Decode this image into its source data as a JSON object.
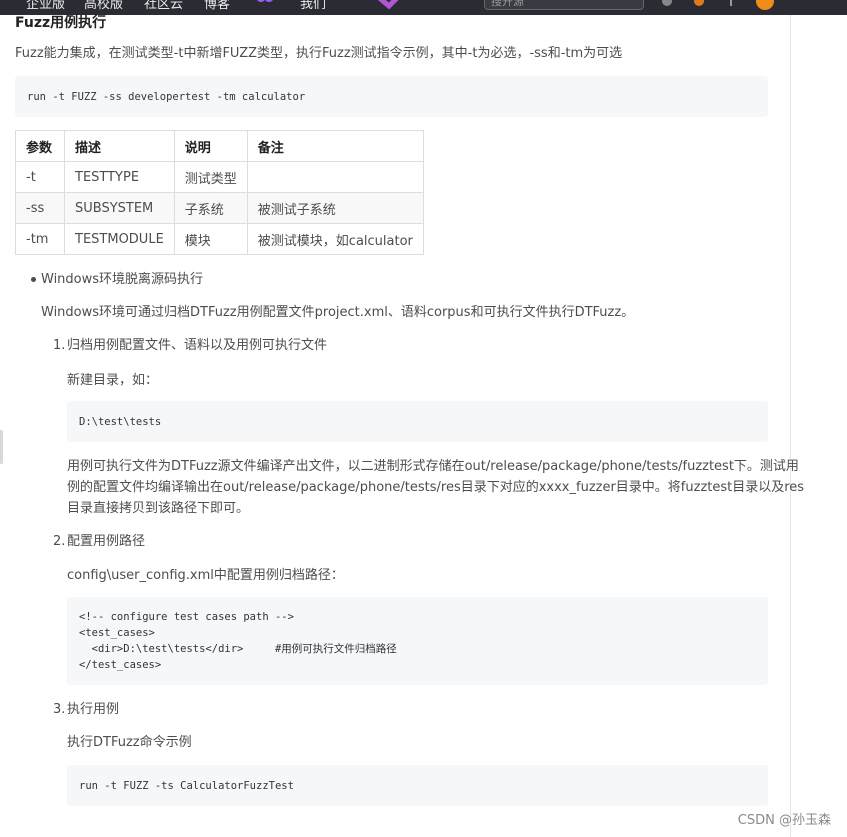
{
  "topbar": {
    "items": [
      "企业版",
      "高校版",
      "社区云",
      "博客",
      "我们"
    ],
    "search_placeholder": "搜开源"
  },
  "section": {
    "title": "Fuzz用例执行",
    "intro": "Fuzz能力集成，在测试类型-t中新增FUZZ类型，执行Fuzz测试指令示例，其中-t为必选，-ss和-tm为可选",
    "command_1": "run -t FUZZ -ss developertest -tm calculator"
  },
  "table": {
    "headers": [
      "参数",
      "描述",
      "说明",
      "备注"
    ],
    "rows": [
      [
        "-t",
        "TESTTYPE",
        "测试类型",
        ""
      ],
      [
        "-ss",
        "SUBSYSTEM",
        "子系统",
        "被测试子系统"
      ],
      [
        "-tm",
        "TESTMODULE",
        "模块",
        "被测试模块，如calculator"
      ]
    ]
  },
  "windows": {
    "bullet": "Windows环境脱离源码执行",
    "desc": "Windows环境可通过归档DTFuzz用例配置文件project.xml、语料corpus和可执行文件执行DTFuzz。",
    "steps": [
      {
        "num": "1.",
        "title": "归档用例配置文件、语料以及用例可执行文件",
        "text1": "新建目录，如：",
        "code": [
          "D:\\test\\tests"
        ],
        "text2_lines": [
          "用例可执行文件为DTFuzz源文件编译产出文件，以二进制形式存储在out/release/package/phone/tests/fuzztest下。测试用",
          "例的配置文件均编译输出在out/release/package/phone/tests/res目录下对应的xxxx_fuzzer目录中。将fuzztest目录以及res",
          "目录直接拷贝到该路径下即可。"
        ]
      },
      {
        "num": "2.",
        "title": "配置用例路径",
        "text1": "config\\user_config.xml中配置用例归档路径：",
        "code": [
          "<!-- configure test cases path -->",
          "<test_cases>",
          "  <dir>D:\\test\\tests</dir>     #用例可执行文件归档路径",
          "</test_cases>"
        ]
      },
      {
        "num": "3.",
        "title": "执行用例",
        "text1": "执行DTFuzz命令示例",
        "code": [
          "run -t FUZZ -ts CalculatorFuzzTest"
        ]
      }
    ]
  },
  "watermark": "CSDN @孙玉森",
  "colors": {
    "topbar": "#2b2c33",
    "code_bg": "#f6f7f9",
    "accent": "#f08c1a"
  }
}
